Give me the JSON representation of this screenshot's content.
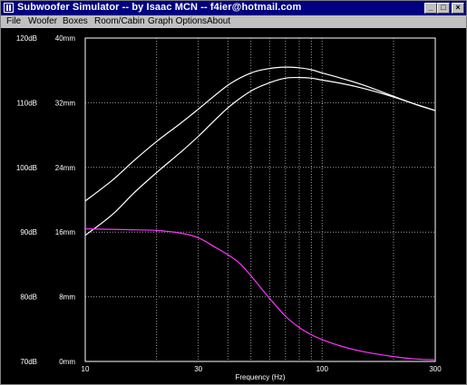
{
  "window": {
    "title": "Subwoofer Simulator -- by Isaac MCN -- f4ier@hotmail.com",
    "minimize": "_",
    "maximize": "□",
    "close": "×"
  },
  "menu": {
    "items": [
      "File",
      "Woofer",
      "Boxes",
      "Room/Cabin",
      "Graph Options",
      "About"
    ]
  },
  "colors": {
    "background": "#000000",
    "grid": "#9a9a9a",
    "response_curves": "#ffffff",
    "excursion_curve": "#ff33ff"
  },
  "chart_data": {
    "type": "line",
    "x_scale": "log",
    "xlabel": "Frequency (Hz)",
    "xlim": [
      10,
      300
    ],
    "x_ticks": [
      "10",
      "30",
      "100",
      "300"
    ],
    "y_left_ticks": [
      "120dB",
      "110dB",
      "100dB",
      "90dB",
      "80dB",
      "70dB"
    ],
    "y_left_range": [
      70,
      120
    ],
    "y_right_ticks": [
      "40mm",
      "32mm",
      "24mm",
      "16mm",
      "8mm",
      "0mm"
    ],
    "y_right_range": [
      0,
      40
    ],
    "grid": true,
    "series": [
      {
        "axis": "left",
        "x": [
          10,
          13,
          16,
          20,
          25,
          30,
          40,
          50,
          60,
          70,
          80,
          90,
          100,
          120,
          150,
          200,
          250,
          300
        ],
        "y": [
          94.8,
          98.0,
          101.0,
          104.0,
          106.7,
          109.0,
          112.7,
          114.6,
          115.3,
          115.5,
          115.4,
          115.1,
          114.6,
          113.8,
          112.7,
          111.0,
          109.7,
          108.8
        ]
      },
      {
        "axis": "left",
        "x": [
          10,
          13,
          16,
          20,
          25,
          30,
          40,
          50,
          60,
          70,
          80,
          90,
          100,
          120,
          150,
          200,
          250,
          300
        ],
        "y": [
          89.5,
          92.7,
          96.0,
          99.2,
          102.2,
          104.8,
          109.2,
          111.8,
          113.1,
          113.8,
          113.9,
          113.8,
          113.5,
          113.0,
          112.2,
          110.9,
          109.7,
          108.8
        ]
      },
      {
        "axis": "right",
        "x": [
          10,
          15,
          20,
          25,
          30,
          35,
          40,
          45,
          50,
          60,
          70,
          80,
          90,
          100,
          120,
          150,
          200,
          250,
          300
        ],
        "y": [
          16.4,
          16.3,
          16.2,
          15.9,
          15.3,
          14.2,
          13.2,
          12.1,
          10.6,
          7.8,
          5.6,
          4.2,
          3.3,
          2.7,
          1.9,
          1.2,
          0.6,
          0.3,
          0.2
        ]
      }
    ]
  }
}
